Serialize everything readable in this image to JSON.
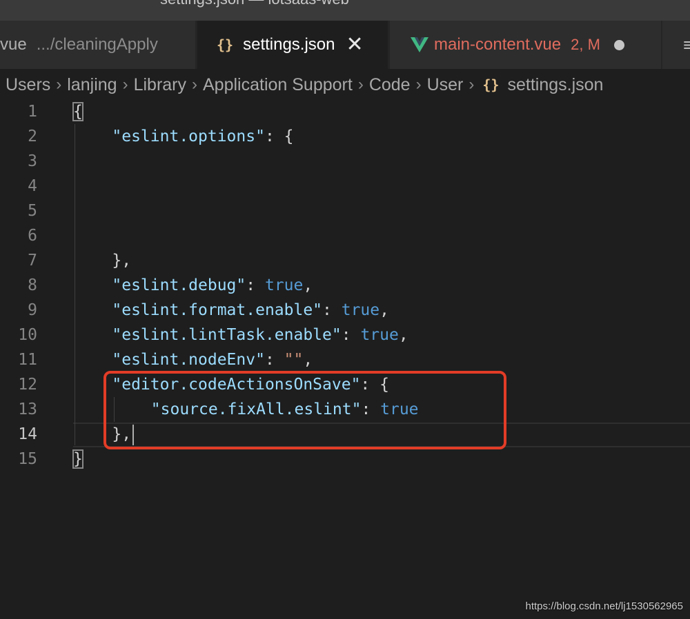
{
  "window": {
    "title": "settings.json — iotsaas-web"
  },
  "tabs": [
    {
      "name": "vue",
      "description": ".../cleaningApply",
      "state": "inactive"
    },
    {
      "name": "settings.json",
      "icon": "json-braces-icon",
      "icon_glyph": "{}",
      "state": "active",
      "close_glyph": "✕"
    },
    {
      "name": "main-content.vue",
      "icon": "vue-logo-icon",
      "badge": "2, M",
      "modified": true,
      "state": "inactive"
    },
    {
      "icon": "more-actions-icon",
      "glyph": "≡"
    }
  ],
  "breadcrumb": {
    "items": [
      "Users",
      "lanjing",
      "Library",
      "Application Support",
      "Code",
      "User"
    ],
    "separator": "›",
    "file": {
      "icon_glyph": "{}",
      "name": "settings.json"
    }
  },
  "editor": {
    "current_line": 14,
    "lines": [
      {
        "number": "1",
        "tokens": [
          {
            "t": "p",
            "v": "{"
          }
        ]
      },
      {
        "number": "2",
        "tokens": [
          {
            "t": "k",
            "v": "\"eslint.options\""
          },
          {
            "t": "p",
            "v": ": {"
          }
        ]
      },
      {
        "number": "3",
        "tokens": []
      },
      {
        "number": "4",
        "tokens": []
      },
      {
        "number": "5",
        "tokens": []
      },
      {
        "number": "6",
        "tokens": []
      },
      {
        "number": "7",
        "tokens": [
          {
            "t": "p",
            "v": "},"
          }
        ]
      },
      {
        "number": "8",
        "tokens": [
          {
            "t": "k",
            "v": "\"eslint.debug\""
          },
          {
            "t": "p",
            "v": ": "
          },
          {
            "t": "b",
            "v": "true"
          },
          {
            "t": "p",
            "v": ","
          }
        ]
      },
      {
        "number": "9",
        "tokens": [
          {
            "t": "k",
            "v": "\"eslint.format.enable\""
          },
          {
            "t": "p",
            "v": ": "
          },
          {
            "t": "b",
            "v": "true"
          },
          {
            "t": "p",
            "v": ","
          }
        ]
      },
      {
        "number": "10",
        "tokens": [
          {
            "t": "k",
            "v": "\"eslint.lintTask.enable\""
          },
          {
            "t": "p",
            "v": ": "
          },
          {
            "t": "b",
            "v": "true"
          },
          {
            "t": "p",
            "v": ","
          }
        ]
      },
      {
        "number": "11",
        "tokens": [
          {
            "t": "k",
            "v": "\"eslint.nodeEnv\""
          },
          {
            "t": "p",
            "v": ": "
          },
          {
            "t": "s",
            "v": "\"\""
          },
          {
            "t": "p",
            "v": ","
          }
        ]
      },
      {
        "number": "12",
        "tokens": [
          {
            "t": "k",
            "v": "\"editor.codeActionsOnSave\""
          },
          {
            "t": "p",
            "v": ": {"
          }
        ]
      },
      {
        "number": "13",
        "tokens": [
          {
            "t": "k",
            "v": "\"source.fixAll.eslint\""
          },
          {
            "t": "p",
            "v": ": "
          },
          {
            "t": "b",
            "v": "true"
          }
        ]
      },
      {
        "number": "14",
        "tokens": [
          {
            "t": "p",
            "v": "},"
          }
        ]
      },
      {
        "number": "15",
        "tokens": [
          {
            "t": "p",
            "v": "}"
          }
        ]
      }
    ]
  },
  "annotation": {
    "color": "#e23c27",
    "highlighted_lines": "12-14"
  },
  "watermark": "https://blog.csdn.net/lj1530562965",
  "colors": {
    "background": "#1e1e1e",
    "key": "#9cdcfe",
    "boolean": "#569cd6",
    "string": "#ce9178",
    "modified_tab": "#e06c5e",
    "json_icon": "#e2c08d",
    "vue_logo": "#41b883"
  }
}
